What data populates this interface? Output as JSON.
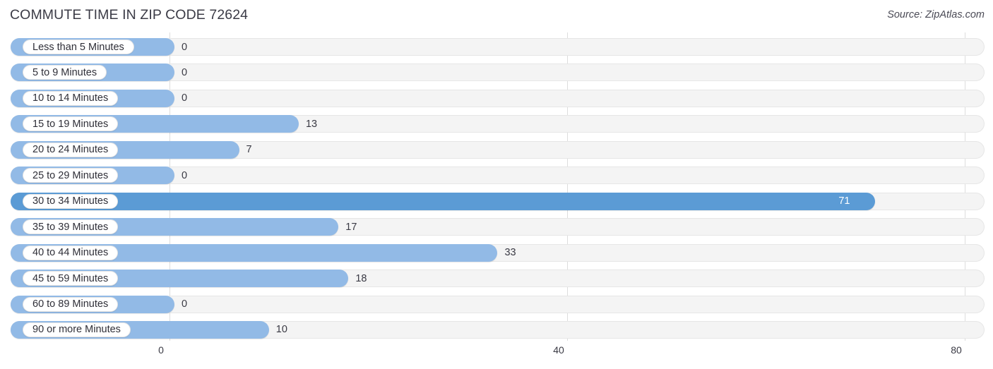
{
  "header": {
    "title": "COMMUTE TIME IN ZIP CODE 72624",
    "source": "Source: ZipAtlas.com"
  },
  "chart_data": {
    "type": "bar",
    "orientation": "horizontal",
    "title": "COMMUTE TIME IN ZIP CODE 72624",
    "xlabel": "",
    "ylabel": "",
    "xlim": [
      0,
      80
    ],
    "xticks": [
      0,
      40,
      80
    ],
    "xtick_labels": [
      "0",
      "40",
      "80"
    ],
    "grid": true,
    "legend": false,
    "bar_color": "#92bae6",
    "highlight_color": "#5b9bd5",
    "track_color": "#f4f4f4",
    "highlight_category": "30 to 34 Minutes",
    "categories": [
      "Less than 5 Minutes",
      "5 to 9 Minutes",
      "10 to 14 Minutes",
      "15 to 19 Minutes",
      "20 to 24 Minutes",
      "25 to 29 Minutes",
      "30 to 34 Minutes",
      "35 to 39 Minutes",
      "40 to 44 Minutes",
      "45 to 59 Minutes",
      "60 to 89 Minutes",
      "90 or more Minutes"
    ],
    "values": [
      0,
      0,
      0,
      13,
      7,
      0,
      71,
      17,
      33,
      18,
      0,
      10
    ],
    "value_labels": [
      "0",
      "0",
      "0",
      "13",
      "7",
      "0",
      "71",
      "17",
      "33",
      "18",
      "0",
      "10"
    ]
  }
}
